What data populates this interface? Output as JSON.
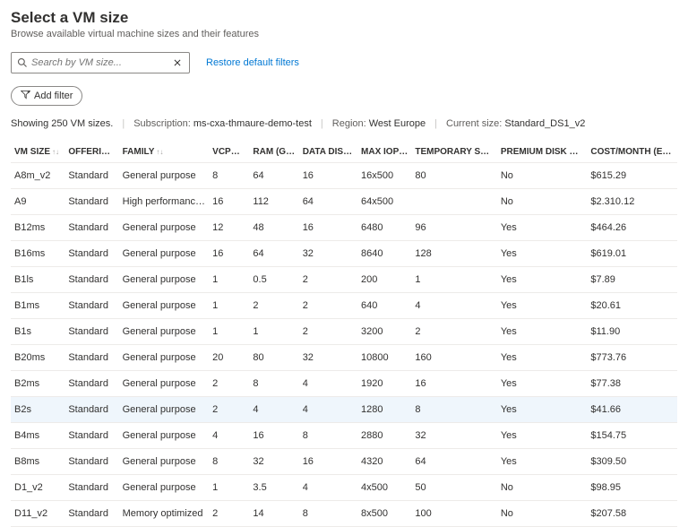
{
  "header": {
    "title": "Select a VM size",
    "subtitle": "Browse available virtual machine sizes and their features"
  },
  "search": {
    "placeholder": "Search by VM size..."
  },
  "restore_label": "Restore default filters",
  "add_filter_label": "Add filter",
  "status": {
    "showing": "Showing 250 VM sizes.",
    "subscription_label": "Subscription:",
    "subscription_value": "ms-cxa-thmaure-demo-test",
    "region_label": "Region:",
    "region_value": "West Europe",
    "current_label": "Current size:",
    "current_value": "Standard_DS1_v2"
  },
  "columns": {
    "vmsize": "VM SIZE",
    "offering": "OFFERING",
    "family": "FAMILY",
    "vcpus": "VCPUS",
    "ram": "RAM (GI...",
    "disks": "DATA DISKS",
    "iops": "MAX IOPS",
    "temp": "TEMPORARY STOR...",
    "premium": "PREMIUM DISK SUP...",
    "cost": "COST/MONTH (ESTI..."
  },
  "rows": [
    {
      "vmsize": "A8m_v2",
      "offering": "Standard",
      "family": "General purpose",
      "vcpus": "8",
      "ram": "64",
      "disks": "16",
      "iops": "16x500",
      "temp": "80",
      "premium": "No",
      "cost": "$615.29",
      "selected": false
    },
    {
      "vmsize": "A9",
      "offering": "Standard",
      "family": "High performance c...",
      "vcpus": "16",
      "ram": "112",
      "disks": "64",
      "iops": "64x500",
      "temp": "",
      "premium": "No",
      "cost": "$2.310.12",
      "selected": false
    },
    {
      "vmsize": "B12ms",
      "offering": "Standard",
      "family": "General purpose",
      "vcpus": "12",
      "ram": "48",
      "disks": "16",
      "iops": "6480",
      "temp": "96",
      "premium": "Yes",
      "cost": "$464.26",
      "selected": false
    },
    {
      "vmsize": "B16ms",
      "offering": "Standard",
      "family": "General purpose",
      "vcpus": "16",
      "ram": "64",
      "disks": "32",
      "iops": "8640",
      "temp": "128",
      "premium": "Yes",
      "cost": "$619.01",
      "selected": false
    },
    {
      "vmsize": "B1ls",
      "offering": "Standard",
      "family": "General purpose",
      "vcpus": "1",
      "ram": "0.5",
      "disks": "2",
      "iops": "200",
      "temp": "1",
      "premium": "Yes",
      "cost": "$7.89",
      "selected": false
    },
    {
      "vmsize": "B1ms",
      "offering": "Standard",
      "family": "General purpose",
      "vcpus": "1",
      "ram": "2",
      "disks": "2",
      "iops": "640",
      "temp": "4",
      "premium": "Yes",
      "cost": "$20.61",
      "selected": false
    },
    {
      "vmsize": "B1s",
      "offering": "Standard",
      "family": "General purpose",
      "vcpus": "1",
      "ram": "1",
      "disks": "2",
      "iops": "3200",
      "temp": "2",
      "premium": "Yes",
      "cost": "$11.90",
      "selected": false
    },
    {
      "vmsize": "B20ms",
      "offering": "Standard",
      "family": "General purpose",
      "vcpus": "20",
      "ram": "80",
      "disks": "32",
      "iops": "10800",
      "temp": "160",
      "premium": "Yes",
      "cost": "$773.76",
      "selected": false
    },
    {
      "vmsize": "B2ms",
      "offering": "Standard",
      "family": "General purpose",
      "vcpus": "2",
      "ram": "8",
      "disks": "4",
      "iops": "1920",
      "temp": "16",
      "premium": "Yes",
      "cost": "$77.38",
      "selected": false
    },
    {
      "vmsize": "B2s",
      "offering": "Standard",
      "family": "General purpose",
      "vcpus": "2",
      "ram": "4",
      "disks": "4",
      "iops": "1280",
      "temp": "8",
      "premium": "Yes",
      "cost": "$41.66",
      "selected": true
    },
    {
      "vmsize": "B4ms",
      "offering": "Standard",
      "family": "General purpose",
      "vcpus": "4",
      "ram": "16",
      "disks": "8",
      "iops": "2880",
      "temp": "32",
      "premium": "Yes",
      "cost": "$154.75",
      "selected": false
    },
    {
      "vmsize": "B8ms",
      "offering": "Standard",
      "family": "General purpose",
      "vcpus": "8",
      "ram": "32",
      "disks": "16",
      "iops": "4320",
      "temp": "64",
      "premium": "Yes",
      "cost": "$309.50",
      "selected": false
    },
    {
      "vmsize": "D1_v2",
      "offering": "Standard",
      "family": "General purpose",
      "vcpus": "1",
      "ram": "3.5",
      "disks": "4",
      "iops": "4x500",
      "temp": "50",
      "premium": "No",
      "cost": "$98.95",
      "selected": false
    },
    {
      "vmsize": "D11_v2",
      "offering": "Standard",
      "family": "Memory optimized",
      "vcpus": "2",
      "ram": "14",
      "disks": "8",
      "iops": "8x500",
      "temp": "100",
      "premium": "No",
      "cost": "$207.58",
      "selected": false
    }
  ]
}
